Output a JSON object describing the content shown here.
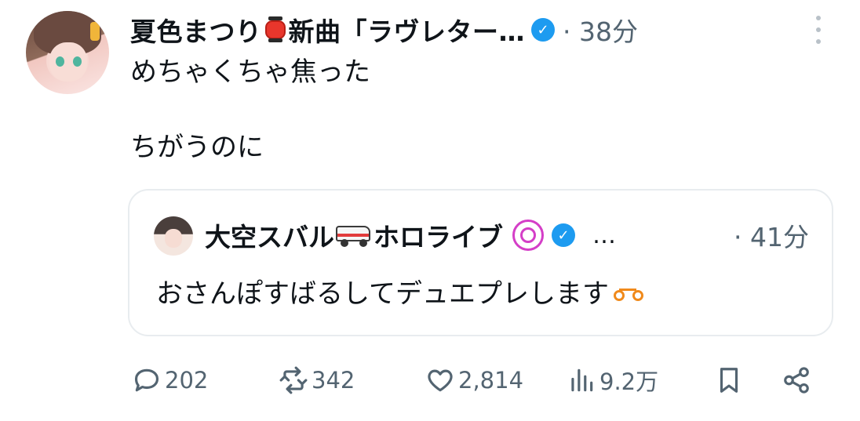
{
  "tweet": {
    "author": {
      "display_name": "夏色まつり",
      "name_suffix": "新曲「ラヴレター…",
      "verified_mark": "✓",
      "time": "· 38分"
    },
    "text": "めちゃくちゃ焦った\n\nちがうのに",
    "quoted": {
      "name_part1": "大空スバル",
      "name_part2": "ホロライブ",
      "verified_mark": "✓",
      "ellipsis": "…",
      "time": "· 41分",
      "text": "おさんぽすばるしてデュエプレします"
    },
    "actions": {
      "replies": "202",
      "retweets": "342",
      "likes": "2,814",
      "views": "9.2万"
    },
    "colors": {
      "verified": "#1d9bf0",
      "muted": "#536471",
      "border": "#e8ecef"
    },
    "icons": [
      "lantern-emoji",
      "ambulance-emoji",
      "swirl-emoji",
      "bicycle-emoji",
      "reply-icon",
      "retweet-icon",
      "like-icon",
      "views-icon",
      "bookmark-icon",
      "share-icon",
      "more-icon"
    ]
  }
}
